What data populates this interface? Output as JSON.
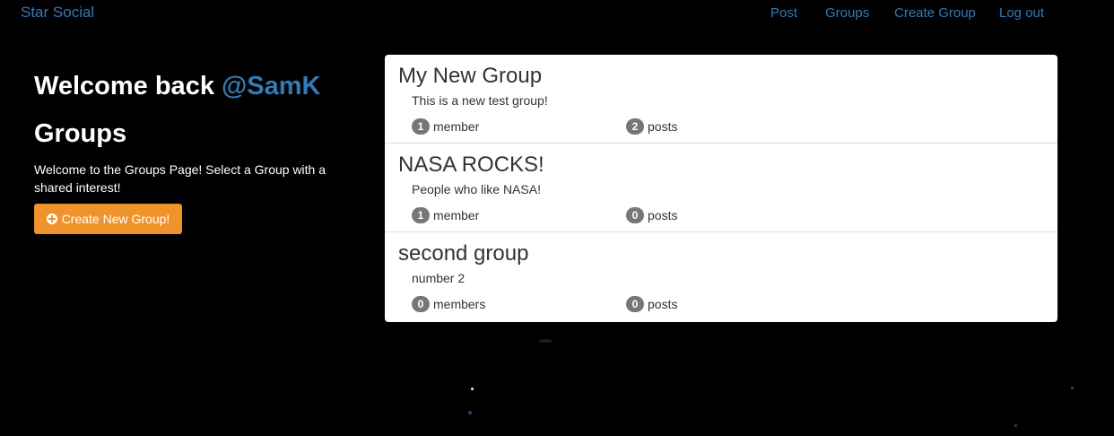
{
  "navbar": {
    "brand": "Star Social",
    "links": [
      {
        "label": "Post"
      },
      {
        "label": "Groups"
      },
      {
        "label": "Create Group"
      },
      {
        "label": "Log out"
      }
    ]
  },
  "sidebar": {
    "welcome_prefix": "Welcome back ",
    "username": "@SamK",
    "heading": "Groups",
    "intro": "Welcome to the Groups Page! Select a Group with a shared interest!",
    "create_button_label": "Create New Group!"
  },
  "groups": [
    {
      "title": "My New Group",
      "description": "This is a new test group!",
      "member_count": "1",
      "member_label": "member",
      "post_count": "2",
      "post_label": "posts"
    },
    {
      "title": "NASA ROCKS!",
      "description": "People who like NASA!",
      "member_count": "1",
      "member_label": "member",
      "post_count": "0",
      "post_label": "posts"
    },
    {
      "title": "second group",
      "description": "number 2",
      "member_count": "0",
      "member_label": "members",
      "post_count": "0",
      "post_label": "posts"
    }
  ],
  "colors": {
    "background": "#000000",
    "link": "#337ab7",
    "button": "#f0932b",
    "badge": "#777777"
  },
  "icons": {
    "create_button_icon": "plus-circle-icon"
  }
}
